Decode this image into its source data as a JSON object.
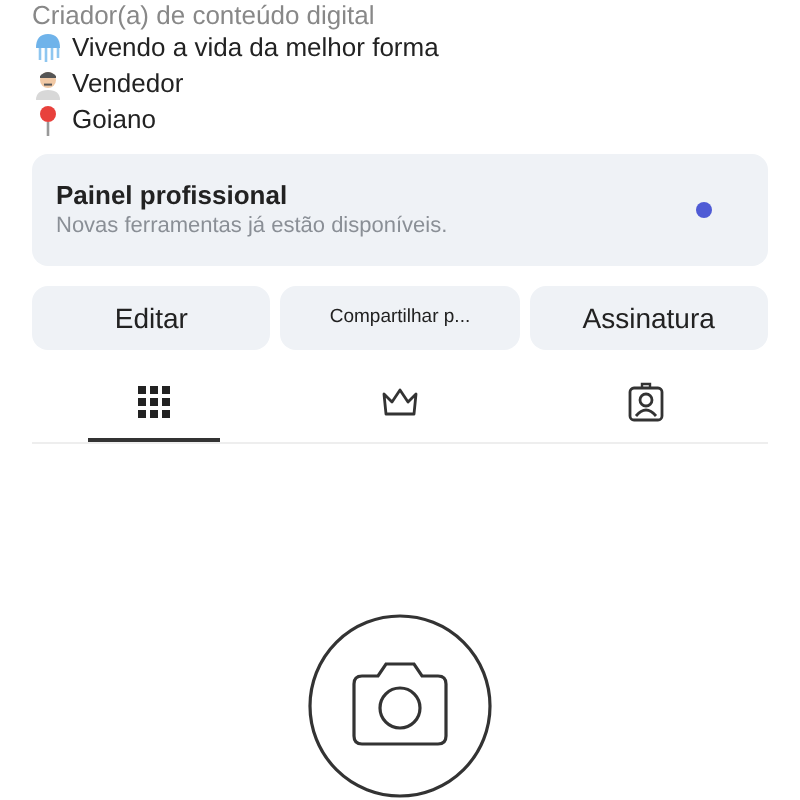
{
  "bio": {
    "category": "Criador(a) de conteúdo digital",
    "lines": [
      {
        "kind": "jellyfish",
        "text": "Vivendo a vida da melhor forma"
      },
      {
        "kind": "man",
        "text": "Vendedor"
      },
      {
        "kind": "pin",
        "text": "Goiano"
      }
    ]
  },
  "panel": {
    "title": "Painel profissional",
    "subtitle": "Novas ferramentas já estão disponíveis.",
    "unread": true
  },
  "buttons": [
    {
      "label": "Editar",
      "kind": "regular"
    },
    {
      "label": "Compartilhar p...",
      "kind": "compact"
    },
    {
      "label": "Assinatura",
      "kind": "regular"
    }
  ],
  "tabs": [
    {
      "kind": "grid",
      "selected": true
    },
    {
      "kind": "crown",
      "selected": false
    },
    {
      "kind": "tagged",
      "selected": false
    }
  ],
  "empty_state": {
    "kind": "camera"
  }
}
